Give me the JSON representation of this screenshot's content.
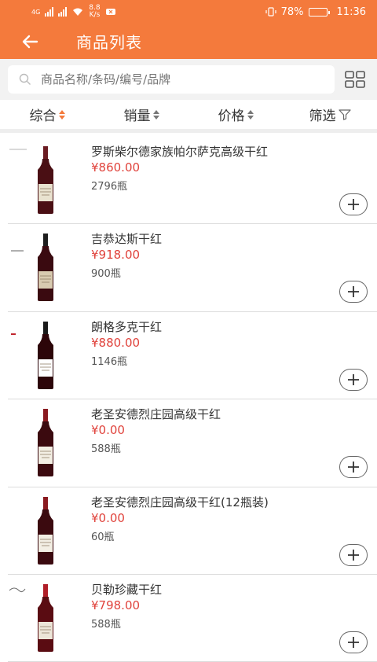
{
  "status_bar": {
    "network": "4G",
    "speed_value": "8.8",
    "speed_unit": "K/s",
    "battery": "78%",
    "battery_level": 0.78,
    "time": "11:36"
  },
  "header": {
    "title": "商品列表",
    "back_icon": "back-arrow-icon"
  },
  "search": {
    "placeholder": "商品名称/条码/编号/品牌",
    "value": "",
    "layout_toggle_icon": "grid-view-icon"
  },
  "sort_bar": {
    "items": [
      {
        "label": "综合",
        "active": true
      },
      {
        "label": "销量",
        "active": false
      },
      {
        "label": "价格",
        "active": false
      },
      {
        "label": "筛选",
        "icon": "filter-icon"
      }
    ]
  },
  "products": [
    {
      "name": "罗斯柴尔德家族帕尔萨克高级干红",
      "price": "¥860.00",
      "stock": "2796瓶"
    },
    {
      "name": "吉恭达斯干红",
      "price": "¥918.00",
      "stock": "900瓶"
    },
    {
      "name": "朗格多克干红",
      "price": "¥880.00",
      "stock": "1146瓶"
    },
    {
      "name": "老圣安德烈庄园高级干红",
      "price": "¥0.00",
      "stock": "588瓶"
    },
    {
      "name": "老圣安德烈庄园高级干红(12瓶装)",
      "price": "¥0.00",
      "stock": "60瓶"
    },
    {
      "name": "贝勒珍藏干红",
      "price": "¥798.00",
      "stock": "588瓶"
    }
  ],
  "colors": {
    "accent": "#f47a3c",
    "price": "#e0433c"
  }
}
